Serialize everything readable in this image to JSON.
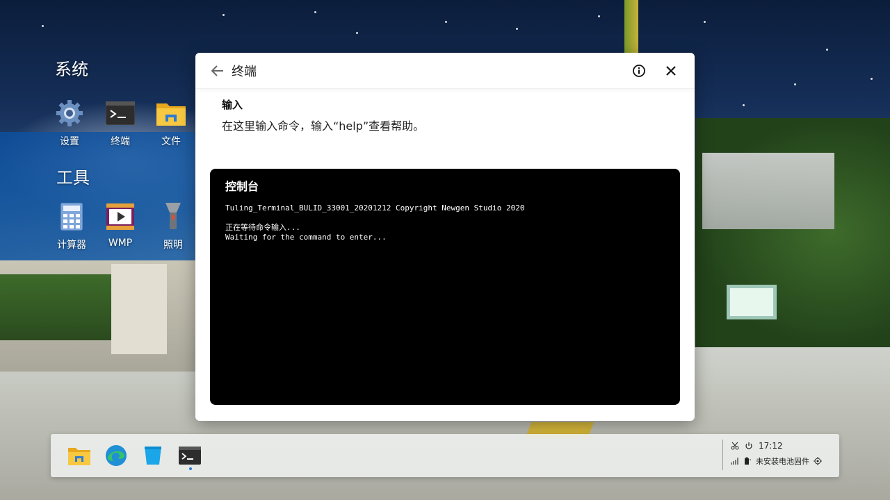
{
  "desktop": {
    "groups": [
      {
        "title": "系统",
        "apps": [
          {
            "label": "设置",
            "icon": "gear-icon"
          },
          {
            "label": "终端",
            "icon": "terminal-icon"
          },
          {
            "label": "文件",
            "icon": "folder-icon"
          }
        ]
      },
      {
        "title": "工具",
        "apps": [
          {
            "label": "计算器",
            "icon": "calculator-icon"
          },
          {
            "label": "WMP",
            "icon": "media-player-icon"
          },
          {
            "label": "照明",
            "icon": "flashlight-icon"
          }
        ]
      }
    ]
  },
  "window": {
    "title": "终端",
    "input_label": "输入",
    "input_hint": "在这里输入命令，输入“help”查看帮助。",
    "console": {
      "title": "控制台",
      "line1": "Tuling_Terminal_BULID_33001_20201212 Copyright Newgen Studio 2020",
      "line2": "正在等待命令输入...",
      "line3": "Waiting for the command to enter..."
    }
  },
  "taskbar": {
    "apps": [
      "folder-icon",
      "edge-icon",
      "store-icon",
      "terminal-icon"
    ],
    "tray": {
      "time": "17:12",
      "battery_status": "未安装电池固件"
    }
  },
  "colors": {
    "accent": "#2a7bd6",
    "console_bg": "#000000",
    "window_bg": "#ffffff"
  }
}
